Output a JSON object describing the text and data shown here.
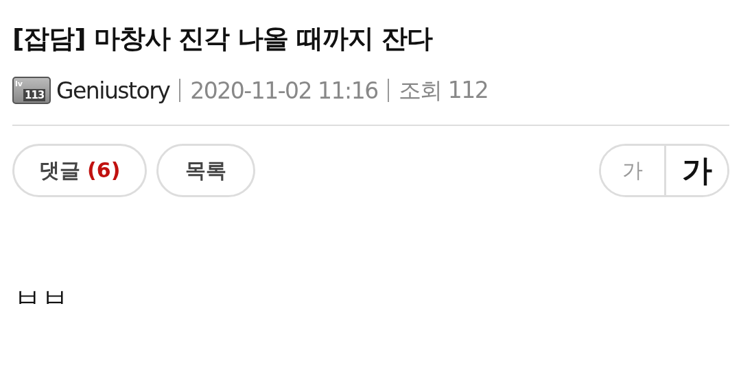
{
  "post": {
    "title": "[잡담] 마창사 진각 나올 때까지 잔다",
    "level_badge": {
      "prefix": "lv",
      "number": "113"
    },
    "author": "Geniustory",
    "date": "2020-11-02 11:16",
    "views": "조회 112"
  },
  "actions": {
    "comments": {
      "label": "댓글",
      "count": "(6)"
    },
    "list": "목록"
  },
  "font_size": [
    {
      "label": "가",
      "kind": "small",
      "selected": false
    },
    {
      "label": "가",
      "kind": "large",
      "selected": true
    }
  ],
  "body": "ㅂㅂ"
}
